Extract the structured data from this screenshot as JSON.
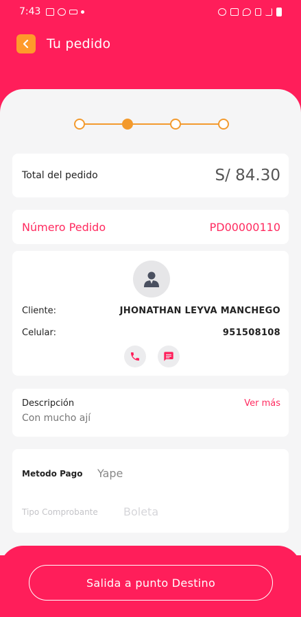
{
  "status_bar": {
    "time": "7:43"
  },
  "header": {
    "title": "Tu pedido"
  },
  "stepper": {
    "total_steps": 4,
    "current_step": 2
  },
  "order": {
    "total_label": "Total del pedido",
    "total_value": "S/ 84.30",
    "number_label": "Número Pedido",
    "number_value": "PD00000110"
  },
  "client": {
    "client_label": "Cliente:",
    "client_name": "JHONATHAN LEYVA MANCHEGO",
    "phone_label": "Celular:",
    "phone_value": "951508108"
  },
  "description": {
    "label": "Descripción",
    "more_link": "Ver más",
    "text": "Con mucho ají"
  },
  "payment": {
    "method_label": "Metodo Pago",
    "method_value": "Yape",
    "receipt_label": "Tipo Comprobante",
    "receipt_value": "Boleta"
  },
  "action": {
    "button_label": "Salida a punto Destino"
  },
  "colors": {
    "primary": "#ff1e5a",
    "accent_orange": "#f39a2d",
    "background": "#f5f5f6"
  }
}
